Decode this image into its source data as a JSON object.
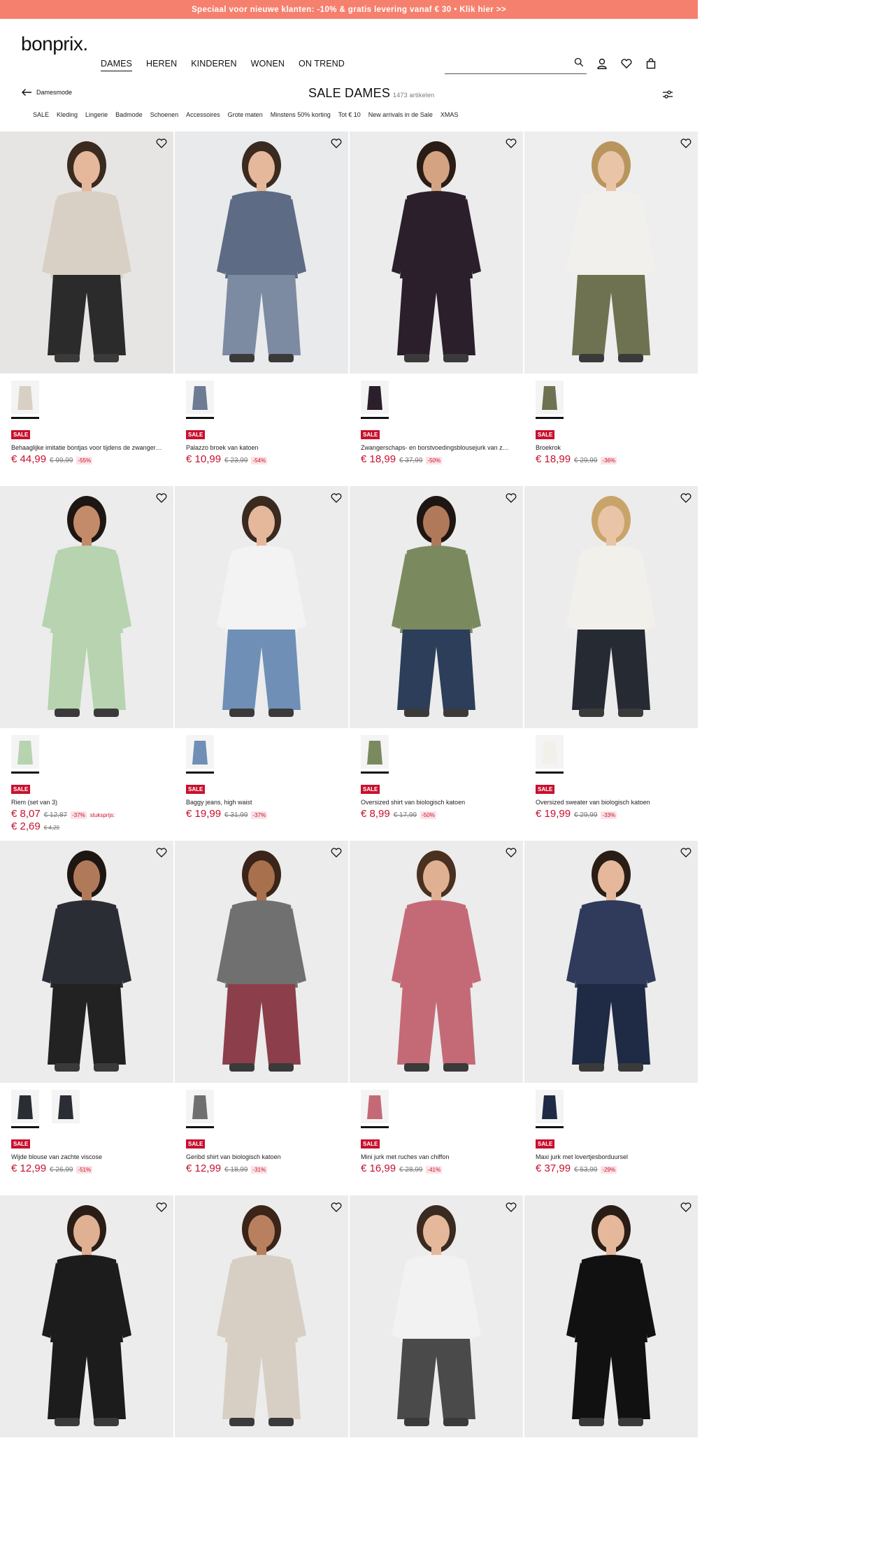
{
  "promo": "Speciaal voor nieuwe klanten: -10% & gratis levering vanaf € 30 • Klik hier >>",
  "brand": "bonprix.",
  "nav": [
    "DAMES",
    "HEREN",
    "KINDEREN",
    "WONEN",
    "ON TREND"
  ],
  "back_label": "Damesmode",
  "page_title": "SALE DAMES",
  "article_count": "1473 artikelen",
  "categories": [
    "SALE",
    "Kleding",
    "Lingerie",
    "Badmode",
    "Schoenen",
    "Accessoires",
    "Grote maten",
    "Minstens 50% korting",
    "Tot € 10",
    "New arrivals in de Sale",
    "XMAS"
  ],
  "badge": "SALE",
  "products": [
    {
      "name": "Behaaglijke imitatie bontjas voor tijdens de zwangerschap",
      "price": "€ 44,99",
      "old": "€ 99,99",
      "disc": "-55%",
      "bg": "#e6e5e3",
      "garment": "#d8d0c4",
      "top": "#d8d0c4",
      "bottom": "#2b2b2b",
      "skin": "#e5b89b",
      "hairc": "#3a2a20"
    },
    {
      "name": "Palazzo broek van katoen",
      "price": "€ 10,99",
      "old": "€ 23,99",
      "disc": "-54%",
      "bg": "#e9eaec",
      "garment": "#6d7b93",
      "top": "#5d6b84",
      "bottom": "#7c8aa2",
      "skin": "#e5b89b",
      "hairc": "#3a2a20"
    },
    {
      "name": "Zwangerschaps- en borstvoedingsblousejurk van zeer fijne stof",
      "price": "€ 18,99",
      "old": "€ 37,99",
      "disc": "-50%",
      "bg": "#ececec",
      "garment": "#2a1f2b",
      "top": "#2a1f2b",
      "bottom": "#2a1f2b",
      "skin": "#d4a381",
      "hairc": "#2a1d16"
    },
    {
      "name": "Broekrok",
      "price": "€ 18,99",
      "old": "€ 29,99",
      "disc": "-36%",
      "bg": "#eeeeee",
      "garment": "#6e7250",
      "top": "#f2f0ec",
      "bottom": "#6e7250",
      "skin": "#eac4a6",
      "hairc": "#b9955e"
    },
    {
      "name": "Riem (set van 3)",
      "price": "€ 8,07",
      "old": "€ 12,87",
      "disc": "-37%",
      "extra": "stuksprijs:",
      "price2": "€ 2,69",
      "old2": "€ 4,29",
      "bg": "#ececec",
      "garment": "#b7d3b0",
      "top": "#b7d3b0",
      "bottom": "#b7d3b0",
      "skin": "#c48b6a",
      "hairc": "#1e1612"
    },
    {
      "name": "Baggy jeans, high waist",
      "price": "€ 19,99",
      "old": "€ 31,99",
      "disc": "-37%",
      "bg": "#ececec",
      "garment": "#6f8fb6",
      "top": "#f3f3f3",
      "bottom": "#6f8fb6",
      "skin": "#e5b89b",
      "hairc": "#3a2a20"
    },
    {
      "name": "Oversized shirt van biologisch katoen",
      "price": "€ 8,99",
      "old": "€ 17,99",
      "disc": "-50%",
      "bg": "#ececec",
      "garment": "#7a8a5e",
      "top": "#7a8a5e",
      "bottom": "#2c3e59",
      "skin": "#b07a5a",
      "hairc": "#1e1612"
    },
    {
      "name": "Oversized sweater van biologisch katoen",
      "price": "€ 19,99",
      "old": "€ 29,99",
      "disc": "-33%",
      "bg": "#ececec",
      "garment": "#f2f0eb",
      "top": "#f2f0eb",
      "bottom": "#262a33",
      "skin": "#eac4a6",
      "hairc": "#c9a46a"
    },
    {
      "name": "Wijde blouse van zachte viscose",
      "price": "€ 12,99",
      "old": "€ 26,99",
      "disc": "-51%",
      "bg": "#ececec",
      "garment": "#2b2d34",
      "top": "#2b2d34",
      "bottom": "#222",
      "skin": "#b07a5a",
      "hairc": "#1e1612"
    },
    {
      "name": "Geribd shirt van biologisch katoen",
      "price": "€ 12,99",
      "old": "€ 18,99",
      "disc": "-31%",
      "bg": "#ececec",
      "garment": "#707070",
      "top": "#707070",
      "bottom": "#8c3f4a",
      "skin": "#a9704e",
      "hairc": "#3a2518"
    },
    {
      "name": "Mini jurk met ruches van chiffon",
      "price": "€ 16,99",
      "old": "€ 28,99",
      "disc": "-41%",
      "bg": "#ececec",
      "garment": "#c46a76",
      "top": "#c46a76",
      "bottom": "#c46a76",
      "skin": "#e0b092",
      "hairc": "#4a3020"
    },
    {
      "name": "Maxi jurk met lovertjesborduursel",
      "price": "€ 37,99",
      "old": "€ 53,99",
      "disc": "-29%",
      "bg": "#ececec",
      "garment": "#1f2a44",
      "top": "#303a5a",
      "bottom": "#1f2a44",
      "skin": "#e5b89b",
      "hairc": "#2a1d16"
    },
    {
      "name": "",
      "bg": "#ececec",
      "garment": "#1c1c1c",
      "top": "#1c1c1c",
      "bottom": "#1c1c1c",
      "skin": "#e0b092",
      "hairc": "#2a1d16"
    },
    {
      "name": "",
      "bg": "#ececec",
      "garment": "#d7cfc4",
      "top": "#d7cfc4",
      "bottom": "#d7cfc4",
      "skin": "#b98060",
      "hairc": "#3a2518"
    },
    {
      "name": "",
      "bg": "#ececec",
      "garment": "#3a3a3a",
      "top": "#f2f2f2",
      "bottom": "#4a4a4a",
      "skin": "#e5b89b",
      "hairc": "#3a2a20"
    },
    {
      "name": "",
      "bg": "#ececec",
      "garment": "#111",
      "top": "#111",
      "bottom": "#111",
      "skin": "#e5b89b",
      "hairc": "#2a1d16"
    }
  ]
}
